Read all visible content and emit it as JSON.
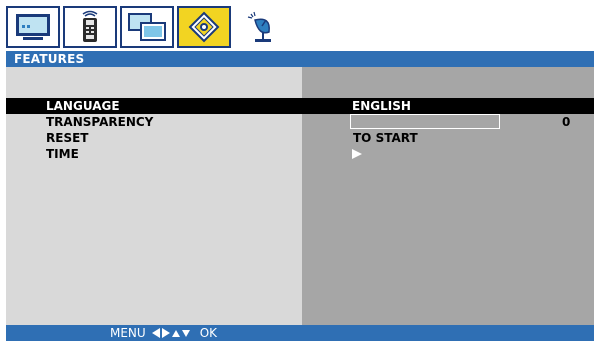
{
  "tabs": [
    {
      "icon": "monitor-picture-icon",
      "active": false
    },
    {
      "icon": "remote-control-icon",
      "active": false
    },
    {
      "icon": "screens-icon",
      "active": false
    },
    {
      "icon": "features-diamond-icon",
      "active": true
    },
    {
      "icon": "satellite-dish-icon",
      "active": false
    }
  ],
  "title": "FEATURES",
  "menu": {
    "items": [
      {
        "label": "LANGUAGE",
        "value": "ENGLISH",
        "selected": true
      },
      {
        "label": "TRANSPARENCY",
        "value": "0",
        "selected": false
      },
      {
        "label": "RESET",
        "value": "TO START",
        "selected": false
      },
      {
        "label": "TIME",
        "value": "",
        "selected": false
      }
    ]
  },
  "transparency": {
    "level": 0
  },
  "footer": {
    "menu_label": "MENU",
    "ok_label": "OK",
    "nav_icons": [
      "arrow-left-icon",
      "arrow-right-icon",
      "arrow-up-icon",
      "arrow-down-icon"
    ]
  },
  "colors": {
    "header_blue": "#2f6fb4",
    "left_panel": "#d9d9d9",
    "right_panel": "#a6a6a6",
    "selected_row": "#000000",
    "active_tab": "#f2d422"
  }
}
